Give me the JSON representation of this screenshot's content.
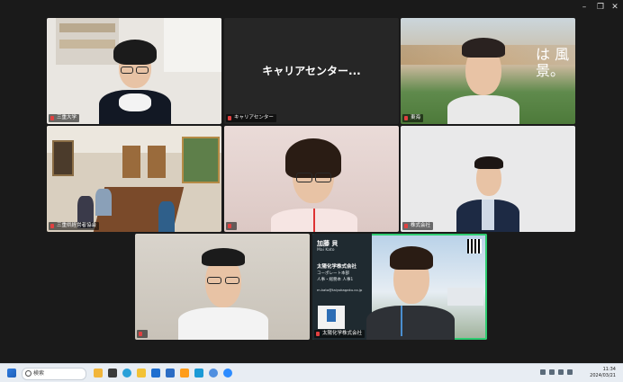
{
  "window_controls": {
    "minimize": "–",
    "restore": "❐",
    "close": "✕"
  },
  "tiles": [
    {
      "id": "t1",
      "name": "三重大学",
      "color": "#e04040"
    },
    {
      "id": "t2",
      "display": "キャリアセンター...",
      "name": "キャリアセンター",
      "color": "#e04040"
    },
    {
      "id": "t3",
      "name": "東海",
      "color": "#e04040"
    },
    {
      "id": "t4",
      "name": "三重県経営者協会",
      "color": "#e04040"
    },
    {
      "id": "t5",
      "name": "",
      "color": "#e04040"
    },
    {
      "id": "t6",
      "name": "株式会社",
      "color": "#e04040"
    },
    {
      "id": "t7",
      "name": "",
      "color": "#e04040"
    },
    {
      "id": "t8",
      "name": "太陽化学株式会社",
      "color": "#e04040"
    }
  ],
  "banner": {
    "surname": "加藤 貝",
    "romaji": "Mai Kato",
    "company": "太陽化学株式会社",
    "division": "コーポレート本部",
    "department": "人事・総務本 人事1",
    "email": "m.kato@taiyokagaku.co.jp"
  },
  "landscape_text": "は 風景。",
  "taskbar": {
    "search_placeholder": "検索",
    "time": "11:34",
    "date": "2024/03/21"
  },
  "icons": [
    "windows-start-icon",
    "search-icon",
    "widgets-icon",
    "task-view-icon",
    "edge-icon",
    "file-explorer-icon",
    "mail-icon",
    "store-icon",
    "amazon-icon",
    "app-icon",
    "edge-dev-icon",
    "zoom-icon"
  ]
}
